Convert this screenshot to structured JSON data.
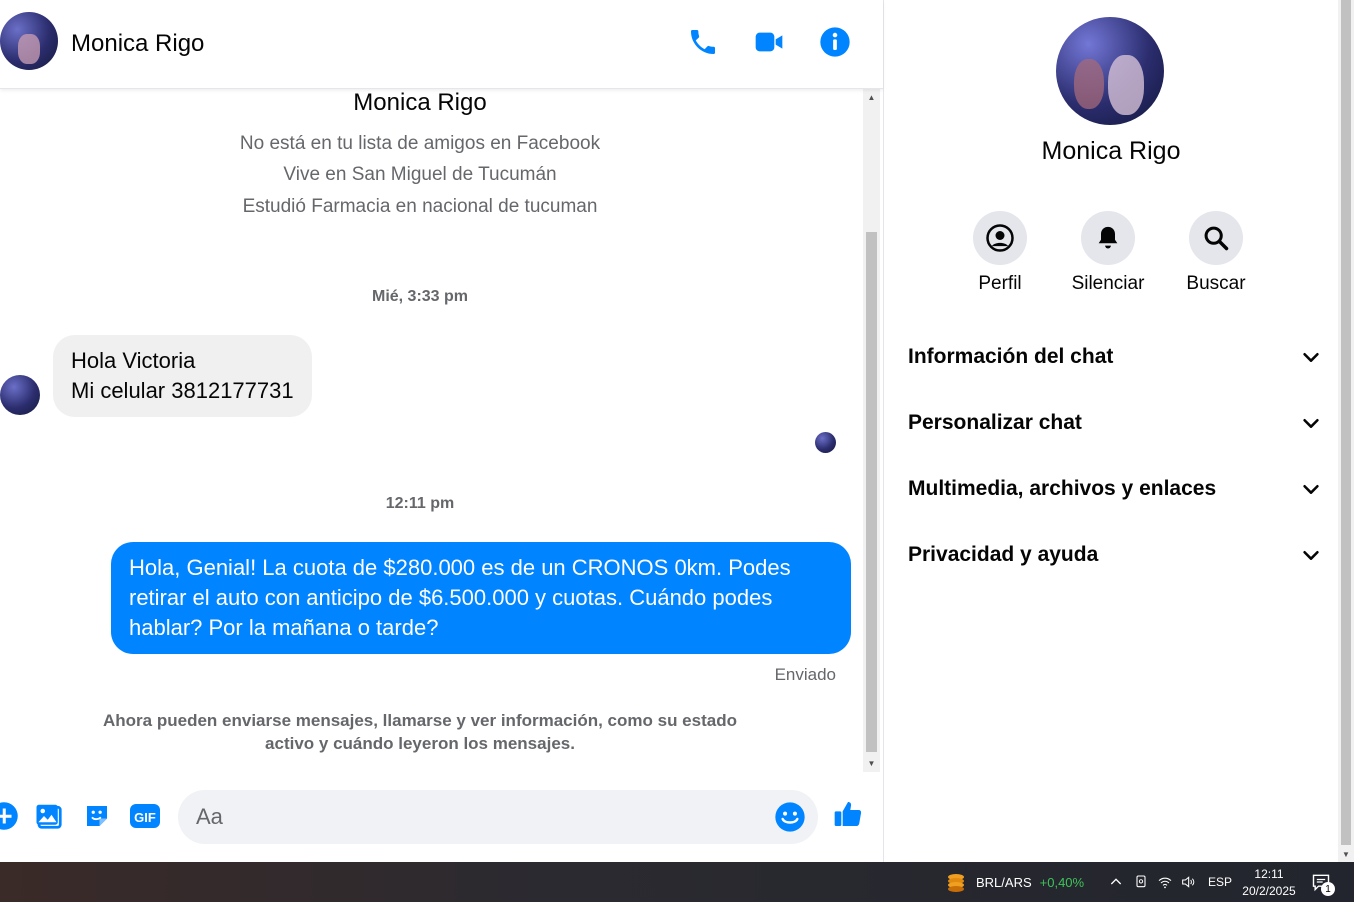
{
  "header": {
    "contact_name": "Monica Rigo",
    "icons": [
      "phone-icon",
      "video-camera-icon",
      "info-icon"
    ]
  },
  "profile_intro": {
    "name": "Monica Rigo",
    "lines": [
      "No está en tu lista de amigos en Facebook",
      "Vive en San Miguel de Tucumán",
      "Estudió Farmacia en nacional de tucuman"
    ]
  },
  "messages": {
    "timestamp_1": "Mié, 3:33 pm",
    "incoming_line_1": "Hola Victoria",
    "incoming_line_2": "Mi celular 3812177731",
    "timestamp_2": "12:11 pm",
    "outgoing_text": "Hola, Genial! La cuota de $280.000 es de un CRONOS 0km. Podes retirar el auto con anticipo de $6.500.000 y cuotas. Cuándo podes hablar? Por la mañana o tarde?",
    "sent_status": "Enviado",
    "notice": "Ahora pueden enviarse mensajes, llamarse y ver información, como su estado activo y cuándo leyeron los mensajes."
  },
  "composer": {
    "placeholder": "Aa",
    "gif_label": "GIF",
    "icons": [
      "plus-icon",
      "image-icon",
      "sticker-icon",
      "gif-icon",
      "emoji-icon",
      "thumbs-up-icon"
    ]
  },
  "right_panel": {
    "name": "Monica Rigo",
    "actions": [
      {
        "label": "Perfil",
        "icon": "profile-icon"
      },
      {
        "label": "Silenciar",
        "icon": "bell-icon"
      },
      {
        "label": "Buscar",
        "icon": "search-icon"
      }
    ],
    "sections": [
      "Información del chat",
      "Personalizar chat",
      "Multimedia, archivos y enlaces",
      "Privacidad y ayuda"
    ]
  },
  "taskbar": {
    "ticker_label": "BRL/ARS",
    "ticker_change": "+0,40%",
    "language": "ESP",
    "time": "12:11",
    "date": "20/2/2025",
    "notification_count": "1"
  },
  "colors": {
    "accent": "#0084ff",
    "incoming_bubble": "#f0f0f0",
    "muted_text": "#65676b",
    "ticker_positive": "#3fc35a"
  }
}
